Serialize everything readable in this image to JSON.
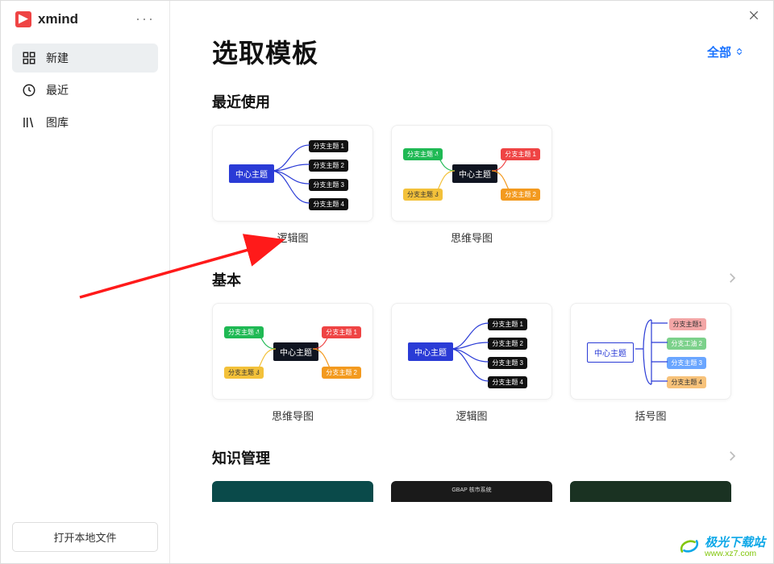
{
  "app": {
    "name": "xmind"
  },
  "sidebar": {
    "items": [
      {
        "label": "新建"
      },
      {
        "label": "最近"
      },
      {
        "label": "图库"
      }
    ],
    "open_button": "打开本地文件"
  },
  "page": {
    "title": "选取模板",
    "filter_label": "全部"
  },
  "sections": {
    "recent": {
      "title": "最近使用"
    },
    "basic": {
      "title": "基本"
    },
    "knowledge": {
      "title": "知识管理"
    }
  },
  "templates": {
    "recent": [
      {
        "label": "逻辑图"
      },
      {
        "label": "思维导图"
      }
    ],
    "basic": [
      {
        "label": "思维导图"
      },
      {
        "label": "逻辑图"
      },
      {
        "label": "括号图"
      }
    ]
  },
  "mm": {
    "center": "中心主题",
    "branch1": "分支主题 1",
    "branch2": "分支主题 2",
    "branch3": "分支主题 3",
    "branch4": "分支主题 4",
    "branchR1": "分支主题1",
    "branchR2": "分支工油 2",
    "branchR3": "分支主题 3",
    "branchR4": "分支主题 4"
  },
  "knowledge_cards": {
    "c1_label": "GBAP 核市系统"
  },
  "watermark": {
    "line1": "极光下载站",
    "line2": "www.xz7.com"
  }
}
